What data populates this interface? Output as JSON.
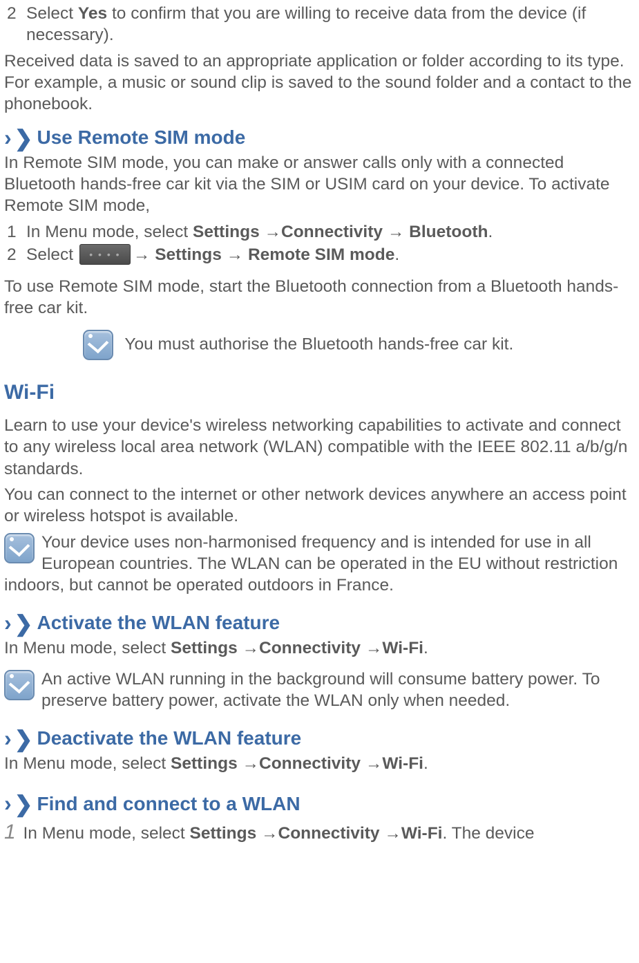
{
  "step2": {
    "num": "2",
    "t1": "Select ",
    "yes": "Yes",
    "t2": " to confirm that you are willing to receive data from the device (if necessary)."
  },
  "received": "Received data is saved to an appropriate application or folder according to its type. For example, a music or sound clip is saved to the sound folder and a contact to the phonebook.",
  "chev": "›",
  "h_remote": "Use Remote SIM mode",
  "remote_p": "In Remote SIM mode, you can make or answer calls only with a connected Bluetooth hands-free car kit via the SIM or USIM card on your device. To activate Remote SIM mode,",
  "rstep1": {
    "num": "1",
    "t1": "In Menu mode, select ",
    "path": "Settings →Connectivity → Bluetooth",
    "t2": "."
  },
  "rstep2": {
    "num": "2",
    "t1": "Select  ",
    "arrow1": "→ Settings → Remote SIM mode",
    "t2": "."
  },
  "remote_use": "To use Remote SIM mode, start the Bluetooth connection from a Bluetooth hands-free car kit.",
  "note_auth": "You must authorise the Bluetooth hands-free car kit.",
  "h_wifi": "Wi-Fi",
  "wifi_p1": "Learn to use your device's wireless networking capabilities to activate and connect to any wireless local area network (WLAN) compatible with the IEEE 802.11 a/b/g/n standards.",
  "wifi_p2": "You can connect to the internet or other network devices anywhere an access point or wireless hotspot is available.",
  "note_freq1": " Your device uses non-harmonised frequency and is intended for use in all European countries. The WLAN can be operated in the EU without restriction indoors, but cannot be operated outdoors in France.",
  "h_activate": "Activate the WLAN feature",
  "act_p": {
    "t1": "In Menu mode, select ",
    "path": "Settings →Connectivity →Wi-Fi",
    "t2": "."
  },
  "note_batt": " An active WLAN running in the background will consume battery power. To preserve battery power, activate the WLAN only when needed.",
  "h_deactivate": "Deactivate the WLAN feature",
  "deact_p": {
    "t1": "In Menu mode, select ",
    "path": "Settings →Connectivity →Wi-Fi",
    "t2": "."
  },
  "h_find": "Find and connect to a WLAN",
  "find_step": {
    "num": "1",
    "t1": " In Menu mode, select ",
    "path": "Settings →Connectivity →Wi-Fi",
    "t2": ". The device"
  }
}
